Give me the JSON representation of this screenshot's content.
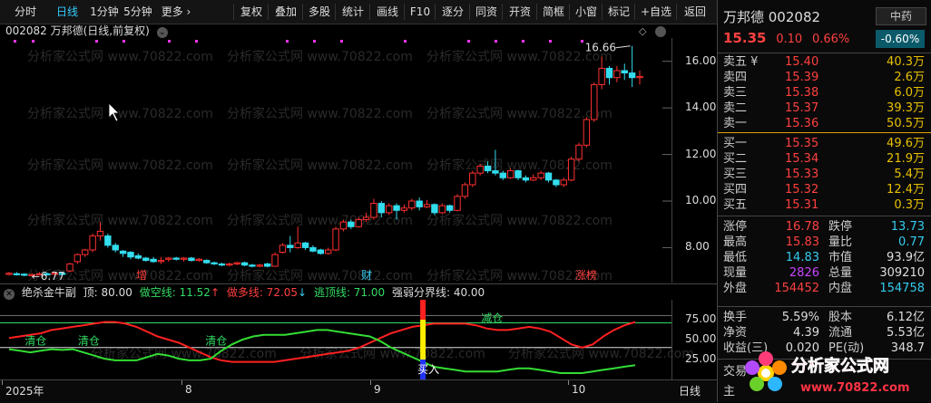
{
  "toolbar": {
    "left_items": [
      "分时",
      "日线",
      "1分钟",
      "5分钟",
      "更多 ›"
    ],
    "active": "日线",
    "right_items": [
      "复权",
      "叠加",
      "多股",
      "统计",
      "画线",
      "F10",
      "逐分",
      "同资",
      "开资",
      "简框",
      "小窗",
      "标记",
      "+自选",
      "返回"
    ]
  },
  "chart": {
    "title": "002082 万邦德(日线,前复权)",
    "price_ticks": [
      "16.00",
      "14.00",
      "12.00",
      "10.00",
      "8.00"
    ],
    "high_label": "16.66",
    "low_label": "6.77",
    "event_tags": [
      {
        "text": "增",
        "color": "#ff4040"
      },
      {
        "text": "财",
        "color": "#33ccee"
      },
      {
        "text": "涨榜",
        "color": "#ff4040"
      }
    ],
    "watermark": "分析家公式网 www.70822.com"
  },
  "chart_data": {
    "type": "candlestick",
    "ylim": [
      6.5,
      17.0
    ],
    "candles": [
      [
        6.85,
        6.9,
        6.8,
        6.95
      ],
      [
        6.88,
        6.85,
        6.8,
        6.95
      ],
      [
        6.86,
        6.82,
        6.77,
        6.9
      ],
      [
        6.8,
        6.84,
        6.77,
        6.9
      ],
      [
        6.84,
        6.87,
        6.8,
        6.95
      ],
      [
        6.88,
        6.85,
        6.8,
        6.93
      ],
      [
        6.86,
        6.9,
        6.82,
        6.95
      ],
      [
        6.9,
        6.85,
        6.8,
        6.95
      ],
      [
        7.0,
        7.3,
        6.95,
        7.35
      ],
      [
        7.4,
        7.7,
        7.3,
        7.75
      ],
      [
        7.7,
        7.9,
        7.6,
        7.95
      ],
      [
        7.9,
        8.5,
        7.8,
        8.6
      ],
      [
        8.5,
        8.7,
        8.3,
        9.1
      ],
      [
        8.5,
        8.1,
        8.0,
        8.6
      ],
      [
        8.1,
        7.9,
        7.8,
        8.2
      ],
      [
        7.85,
        7.75,
        7.6,
        7.9
      ],
      [
        7.8,
        7.6,
        7.5,
        7.85
      ],
      [
        7.65,
        7.55,
        7.5,
        7.75
      ],
      [
        7.55,
        7.45,
        7.4,
        7.6
      ],
      [
        7.5,
        7.4,
        7.35,
        7.6
      ],
      [
        7.4,
        7.45,
        7.3,
        7.6
      ],
      [
        7.5,
        7.55,
        7.4,
        7.6
      ],
      [
        7.55,
        7.5,
        7.45,
        7.6
      ],
      [
        7.5,
        7.55,
        7.4,
        7.6
      ],
      [
        7.55,
        7.45,
        7.4,
        7.6
      ],
      [
        7.45,
        7.5,
        7.4,
        7.55
      ],
      [
        7.45,
        7.35,
        7.3,
        7.5
      ],
      [
        7.35,
        7.3,
        7.25,
        7.4
      ],
      [
        7.3,
        7.25,
        7.2,
        7.35
      ],
      [
        7.25,
        7.3,
        7.2,
        7.35
      ],
      [
        7.3,
        7.35,
        7.25,
        7.4
      ],
      [
        7.35,
        7.25,
        7.2,
        7.4
      ],
      [
        7.25,
        7.2,
        7.15,
        7.3
      ],
      [
        7.2,
        7.25,
        7.15,
        7.3
      ],
      [
        7.3,
        7.2,
        7.15,
        7.35
      ],
      [
        7.2,
        7.7,
        7.2,
        7.8
      ],
      [
        7.8,
        8.1,
        7.75,
        8.2
      ],
      [
        8.1,
        8.0,
        7.8,
        8.5
      ],
      [
        8.0,
        8.2,
        7.95,
        8.9
      ],
      [
        8.2,
        8.0,
        7.9,
        8.25
      ],
      [
        8.0,
        7.85,
        7.8,
        8.1
      ],
      [
        7.9,
        7.75,
        7.7,
        7.95
      ],
      [
        7.75,
        7.9,
        7.7,
        8.0
      ],
      [
        7.9,
        8.8,
        7.85,
        8.9
      ],
      [
        8.8,
        9.1,
        8.7,
        9.2
      ],
      [
        9.1,
        8.9,
        8.8,
        9.2
      ],
      [
        8.9,
        9.2,
        8.85,
        9.3
      ],
      [
        9.2,
        9.3,
        9.1,
        9.5
      ],
      [
        9.3,
        9.9,
        9.2,
        10.1
      ],
      [
        9.9,
        9.5,
        9.3,
        10.0
      ],
      [
        9.5,
        9.8,
        9.4,
        9.9
      ],
      [
        9.8,
        9.6,
        9.2,
        9.9
      ],
      [
        9.6,
        9.7,
        9.5,
        9.85
      ],
      [
        9.7,
        10.0,
        9.6,
        10.1
      ],
      [
        10.0,
        9.75,
        9.6,
        10.15
      ],
      [
        9.75,
        9.85,
        9.7,
        10.05
      ],
      [
        9.85,
        9.5,
        9.4,
        9.9
      ],
      [
        9.5,
        9.8,
        9.45,
        9.9
      ],
      [
        9.8,
        9.6,
        9.5,
        9.85
      ],
      [
        9.6,
        10.2,
        9.55,
        10.3
      ],
      [
        10.2,
        10.7,
        10.1,
        10.8
      ],
      [
        10.7,
        11.2,
        10.6,
        11.3
      ],
      [
        11.2,
        11.5,
        11.1,
        11.6
      ],
      [
        11.5,
        11.3,
        11.2,
        11.7
      ],
      [
        11.3,
        11.2,
        11.1,
        12.2
      ],
      [
        11.2,
        11.0,
        10.9,
        11.3
      ],
      [
        11.0,
        11.3,
        10.95,
        11.4
      ],
      [
        11.3,
        11.0,
        10.9,
        11.35
      ],
      [
        11.0,
        10.9,
        10.8,
        11.1
      ],
      [
        10.9,
        11.0,
        10.85,
        11.15
      ],
      [
        11.0,
        11.2,
        10.9,
        11.3
      ],
      [
        11.2,
        10.9,
        10.8,
        11.25
      ],
      [
        10.9,
        10.7,
        10.6,
        10.95
      ],
      [
        10.7,
        10.9,
        10.6,
        11.0
      ],
      [
        10.9,
        11.8,
        10.85,
        11.9
      ],
      [
        11.8,
        12.4,
        11.7,
        12.5
      ],
      [
        12.4,
        13.5,
        12.3,
        13.6
      ],
      [
        13.5,
        15.0,
        13.4,
        15.1
      ],
      [
        15.0,
        15.7,
        14.8,
        16.2
      ],
      [
        15.7,
        15.3,
        15.0,
        15.8
      ],
      [
        15.3,
        15.6,
        15.1,
        15.8
      ],
      [
        15.6,
        15.5,
        15.2,
        15.9
      ],
      [
        15.5,
        15.3,
        14.9,
        16.66
      ],
      [
        15.3,
        15.35,
        15.0,
        15.6
      ]
    ],
    "indicator": {
      "name": "绝杀金牛副",
      "ylim": [
        0,
        100
      ],
      "ticks": [
        75.0,
        50.0,
        25.0
      ],
      "top": 80.0,
      "zuokong": [
        38,
        36,
        34,
        36,
        38,
        37,
        38,
        34,
        30,
        26,
        24,
        24,
        24,
        28,
        32,
        30,
        26,
        24,
        24,
        26,
        36,
        44,
        50,
        54,
        56,
        56,
        56,
        58,
        60,
        62,
        62,
        60,
        58,
        56,
        54,
        48,
        40,
        34,
        28,
        22,
        16,
        14,
        12,
        10,
        10,
        10,
        10,
        12,
        14,
        14,
        12,
        10,
        8,
        8,
        8,
        10,
        12,
        14,
        16,
        18
      ],
      "zuoduo": [
        52,
        54,
        56,
        58,
        62,
        64,
        66,
        68,
        70,
        72,
        72,
        70,
        66,
        60,
        54,
        50,
        46,
        40,
        34,
        28,
        24,
        22,
        22,
        22,
        22,
        22,
        24,
        26,
        28,
        30,
        32,
        34,
        36,
        40,
        46,
        52,
        58,
        62,
        66,
        68,
        70,
        70,
        70,
        70,
        68,
        64,
        62,
        62,
        64,
        66,
        64,
        60,
        52,
        44,
        40,
        44,
        54,
        62,
        68,
        72
      ],
      "taoding": 71.0,
      "qiangruo": 40.0,
      "labels": [
        {
          "text": "清仓",
          "color": "#33dd66",
          "i": 2
        },
        {
          "text": "清仓",
          "color": "#33dd66",
          "i": 7
        },
        {
          "text": "清仓",
          "color": "#33dd66",
          "i": 19
        },
        {
          "text": "减仓",
          "color": "#33dd66",
          "i": 45
        },
        {
          "text": "买入",
          "color": "#ffffff",
          "i": 39
        }
      ],
      "buy_index": 39
    }
  },
  "indicator_header": {
    "name": "绝杀金牛副",
    "top_label": "顶: 80.00",
    "zuokong": "做空线: 11.52",
    "zuoduo": "做多线: 72.05",
    "taoding": "逃顶线: 71.00",
    "qiangruo": "强弱分界线: 40.00",
    "colors": {
      "zuokong": "#33dd66",
      "zuoduo": "#ff4040",
      "taoding": "#33dd66",
      "qiangruo": "#dddddd"
    }
  },
  "date_axis": {
    "labels": [
      "2025年",
      "8",
      "9",
      "10"
    ],
    "period": "日线"
  },
  "quote": {
    "name_code": "万邦德 002082",
    "sector": "中药",
    "price": "15.35",
    "change": "0.10",
    "change_pct": "0.66%",
    "sector_pct": "-0.60%",
    "asks": [
      {
        "label": "卖五 ¥",
        "price": "15.40",
        "vol": "40.3万"
      },
      {
        "label": "卖四",
        "price": "15.39",
        "vol": "2.6万"
      },
      {
        "label": "卖三",
        "price": "15.38",
        "vol": "6.0万"
      },
      {
        "label": "卖二",
        "price": "15.37",
        "vol": "39.3万"
      },
      {
        "label": "卖一",
        "price": "15.36",
        "vol": "50.5万"
      }
    ],
    "bids": [
      {
        "label": "买一",
        "price": "15.35",
        "vol": "49.6万"
      },
      {
        "label": "买二",
        "price": "15.34",
        "vol": "21.9万"
      },
      {
        "label": "买三",
        "price": "15.33",
        "vol": "5.4万"
      },
      {
        "label": "买四",
        "price": "15.32",
        "vol": "12.4万"
      },
      {
        "label": "买五",
        "price": "15.31",
        "vol": "0.3万"
      }
    ],
    "stats": [
      {
        "l1": "涨停",
        "v1": "16.78",
        "c1": "red",
        "l2": "跌停",
        "v2": "13.73",
        "c2": "cyan"
      },
      {
        "l1": "最高",
        "v1": "15.83",
        "c1": "red",
        "l2": "量比",
        "v2": "0.77",
        "c2": "cyan"
      },
      {
        "l1": "最低",
        "v1": "14.83",
        "c1": "cyan",
        "l2": "市值",
        "v2": "93.9亿",
        "c2": "white"
      },
      {
        "l1": "现量",
        "v1": "2826",
        "c1": "purple",
        "l2": "总量",
        "v2": "309210",
        "c2": "white"
      },
      {
        "l1": "外盘",
        "v1": "154452",
        "c1": "red",
        "l2": "内盘",
        "v2": "154758",
        "c2": "cyan"
      }
    ],
    "stats2": [
      {
        "l1": "换手",
        "v1": "5.59%",
        "c1": "white",
        "l2": "股本",
        "v2": "6.12亿",
        "c2": "white"
      },
      {
        "l1": "净资",
        "v1": "4.39",
        "c1": "white",
        "l2": "流通",
        "v2": "5.53亿",
        "c2": "white"
      },
      {
        "l1": "收益(三)",
        "v1": "0.020",
        "c1": "white",
        "l2": "PE(动)",
        "v2": "348.7",
        "c2": "white"
      }
    ],
    "bottom_labels": [
      "交易",
      "主"
    ]
  },
  "logo": {
    "text": "分析家公式网",
    "url": "www.70822.com"
  }
}
